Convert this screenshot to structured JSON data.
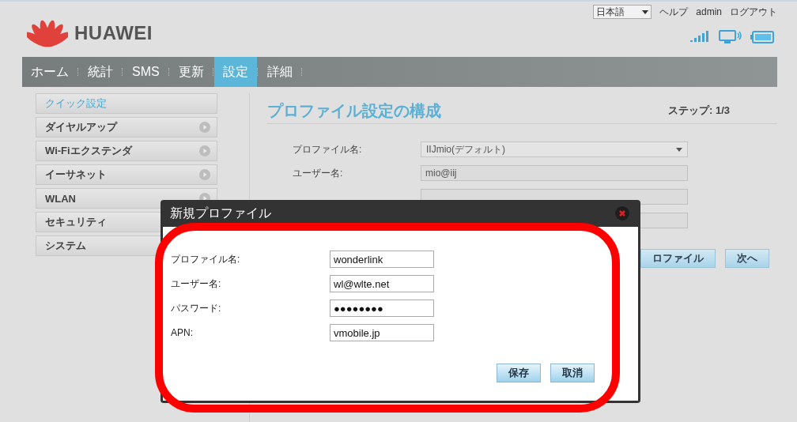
{
  "header": {
    "logo": "HUAWEI",
    "language": "日本語",
    "links": [
      "ヘルプ",
      "admin",
      "ログアウト"
    ]
  },
  "nav": [
    {
      "label": "ホーム",
      "selected": false
    },
    {
      "label": "統計",
      "selected": false
    },
    {
      "label": "SMS",
      "selected": false
    },
    {
      "label": "更新",
      "selected": false
    },
    {
      "label": "設定",
      "selected": true
    },
    {
      "label": "詳細",
      "selected": false
    }
  ],
  "sidebar": [
    {
      "label": "クイック設定",
      "selected": true
    },
    {
      "label": "ダイヤルアップ",
      "selected": false,
      "arrow": true
    },
    {
      "label": "Wi-Fiエクステンダ",
      "selected": false,
      "arrow": true
    },
    {
      "label": "イーサネット",
      "selected": false,
      "arrow": true
    },
    {
      "label": "WLAN",
      "selected": false,
      "arrow": true
    },
    {
      "label": "セキュリティ",
      "selected": false
    },
    {
      "label": "システム",
      "selected": false
    }
  ],
  "main": {
    "title": "プロファイル設定の構成",
    "step": "ステップ: 1/3",
    "fields": [
      {
        "kind": "select",
        "label": "プロファイル名:",
        "value": "IIJmio(デフォルト)"
      },
      {
        "kind": "text",
        "label": "ユーザー名:",
        "value": "mio@iij"
      },
      {
        "kind": "text"
      },
      {
        "kind": "text"
      }
    ],
    "buttons": [
      "ロファイル",
      "次へ"
    ]
  },
  "dialog": {
    "title": "新規プロファイル",
    "fields": [
      {
        "label": "プロファイル名:",
        "value": "wonderlink"
      },
      {
        "label": "ユーザー名:",
        "value": "wl@wlte.net"
      },
      {
        "label": "パスワード:",
        "value": "●●●●●●●●"
      },
      {
        "label": "APN:",
        "value": "vmobile.jp"
      }
    ],
    "buttons": [
      "保存",
      "取消"
    ]
  }
}
